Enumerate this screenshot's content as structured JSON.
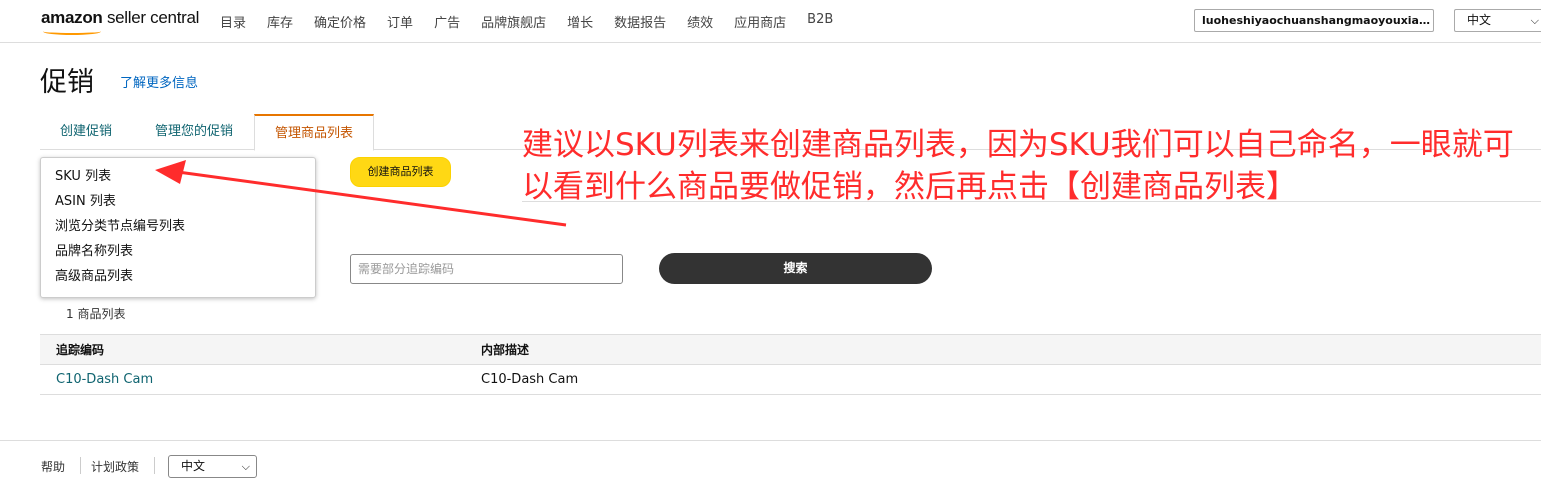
{
  "header": {
    "logo_brand": "amazon",
    "logo_product": "seller central",
    "nav": [
      "目录",
      "库存",
      "确定价格",
      "订单",
      "广告",
      "品牌旗舰店",
      "增长",
      "数据报告",
      "绩效",
      "应用商店",
      "B2B"
    ],
    "account": "luoheshiyaochuanshangmaoyouxiang...",
    "language": "中文"
  },
  "page": {
    "title": "促销",
    "learn_more": "了解更多信息"
  },
  "tabs": [
    "创建促销",
    "管理您的促销",
    "管理商品列表"
  ],
  "dropdown": {
    "items": [
      "SKU 列表",
      "ASIN 列表",
      "浏览分类节点编号列表",
      "品牌名称列表",
      "高级商品列表"
    ]
  },
  "create_button": "创建商品列表",
  "annotation": "建议以SKU列表来创建商品列表，因为SKU我们可以自己命名，一眼就可以看到什么商品要做促销，然后再点击【创建商品列表】",
  "search": {
    "placeholder": "需要部分追踪编码",
    "button": "搜索"
  },
  "list_count": "1 商品列表",
  "table": {
    "columns": [
      "追踪编码",
      "内部描述"
    ],
    "rows": [
      [
        "C10-Dash Cam",
        "C10-Dash Cam"
      ]
    ]
  },
  "footer": {
    "links": [
      "帮助",
      "计划政策"
    ],
    "language": "中文"
  },
  "colors": {
    "accent": "#e77600",
    "button_yellow": "#ffd814",
    "annotation_red": "#ff2c2c",
    "link_teal": "#0f6470"
  }
}
